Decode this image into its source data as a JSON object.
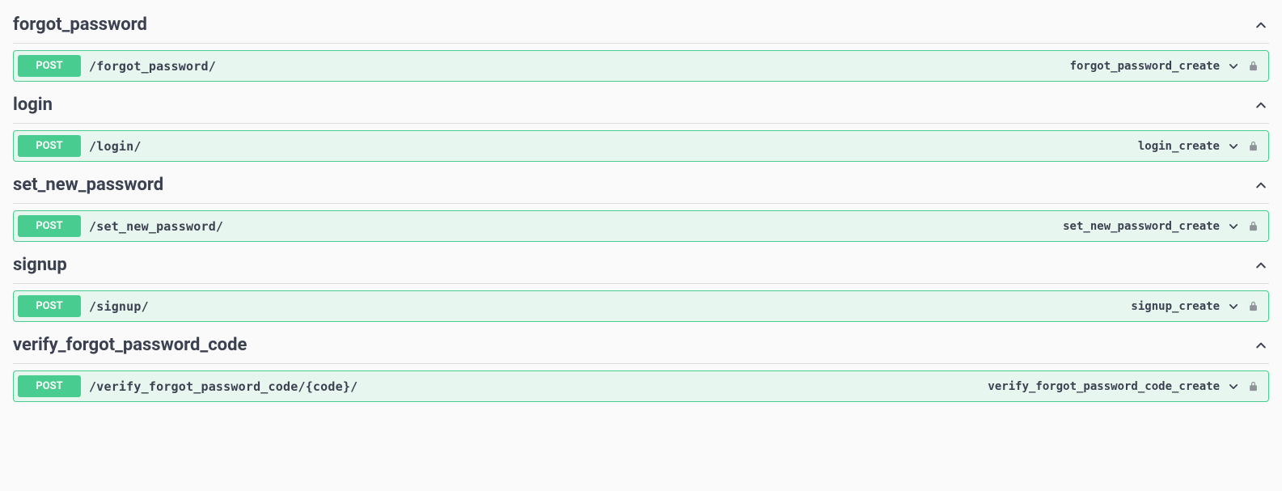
{
  "tags": [
    {
      "name": "forgot_password",
      "operations": [
        {
          "method": "POST",
          "path": "/forgot_password/",
          "operation_id": "forgot_password_create"
        }
      ]
    },
    {
      "name": "login",
      "operations": [
        {
          "method": "POST",
          "path": "/login/",
          "operation_id": "login_create"
        }
      ]
    },
    {
      "name": "set_new_password",
      "operations": [
        {
          "method": "POST",
          "path": "/set_new_password/",
          "operation_id": "set_new_password_create"
        }
      ]
    },
    {
      "name": "signup",
      "operations": [
        {
          "method": "POST",
          "path": "/signup/",
          "operation_id": "signup_create"
        }
      ]
    },
    {
      "name": "verify_forgot_password_code",
      "operations": [
        {
          "method": "POST",
          "path": "/verify_forgot_password_code/{code}/",
          "operation_id": "verify_forgot_password_code_create"
        }
      ]
    }
  ]
}
